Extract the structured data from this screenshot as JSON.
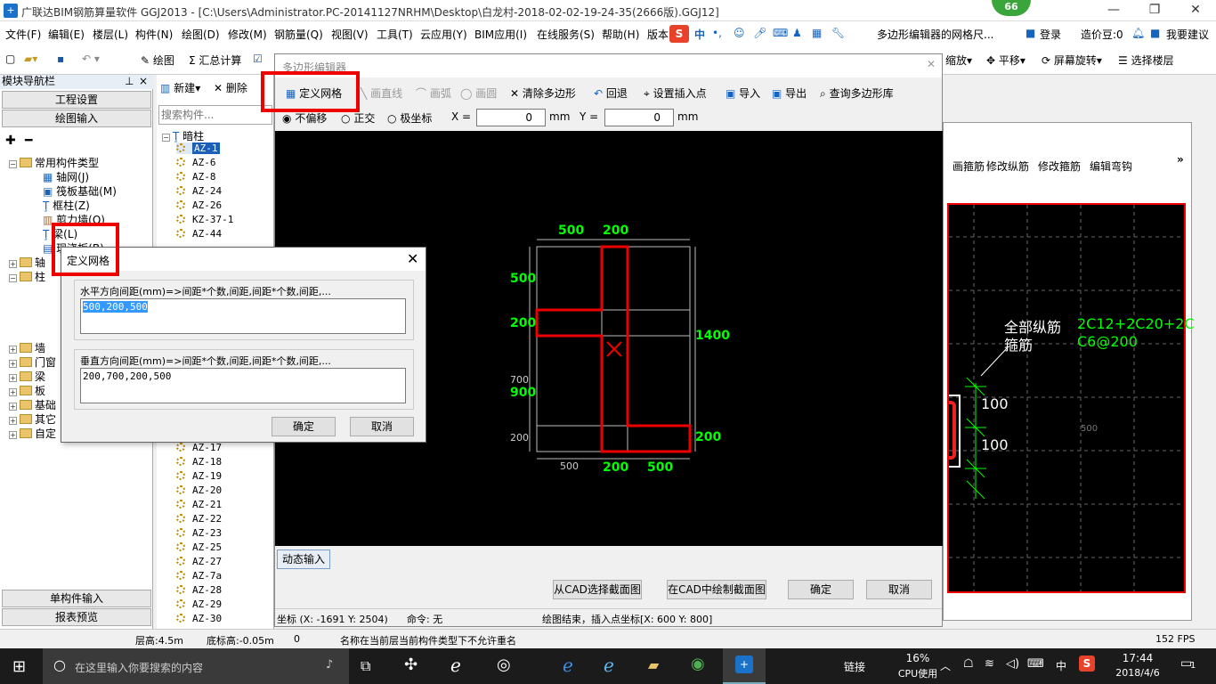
{
  "window": {
    "title": "广联达BIM钢筋算量软件 GGJ2013 - [C:\\Users\\Administrator.PC-20141127NRHM\\Desktop\\白龙村-2018-02-02-19-24-35(2666版).GGJ12]",
    "badge": "66"
  },
  "menu": [
    "文件(F)",
    "编辑(E)",
    "楼层(L)",
    "构件(N)",
    "绘图(D)",
    "修改(M)",
    "钢筋量(Q)",
    "视图(V)",
    "工具(T)",
    "云应用(Y)",
    "BIM应用(I)",
    "在线服务(S)",
    "帮助(H)",
    "版本"
  ],
  "menu_right": {
    "ad": "多边形编辑器的网格尺...",
    "login": "登录",
    "price": "造价豆:0",
    "suggest": "我要建议"
  },
  "toolbar": {
    "draw": "绘图",
    "sum": "汇总计算",
    "zoom": "缩放",
    "pan": "平移",
    "rotate": "屏幕旋转",
    "floor": "选择楼层"
  },
  "left_panel": {
    "header": "模块导航栏",
    "project_settings": "工程设置",
    "drawing_input": "绘图输入",
    "tree": [
      "常用构件类型",
      "轴网(J)",
      "筏板基础(M)",
      "框柱(Z)",
      "剪力墙(Q)",
      "梁(L)",
      "现浇板(B)",
      "轴",
      "柱",
      "墙",
      "门窗",
      "梁",
      "板",
      "基础",
      "其它",
      "自定"
    ],
    "single_input": "单构件输入",
    "report_preview": "报表预览"
  },
  "mid_panel": {
    "new": "新建",
    "delete": "删除",
    "search_placeholder": "搜索构件...",
    "root": "暗柱",
    "items_top": [
      "AZ-1",
      "AZ-6",
      "AZ-8",
      "AZ-24",
      "AZ-26",
      "KZ-37-1",
      "AZ-44"
    ],
    "items_bottom": [
      "AZ-17",
      "AZ-18",
      "AZ-19",
      "AZ-20",
      "AZ-21",
      "AZ-22",
      "AZ-23",
      "AZ-25",
      "AZ-27",
      "AZ-7a",
      "AZ-28",
      "AZ-29",
      "AZ-30"
    ]
  },
  "poly_editor": {
    "title": "多边形编辑器",
    "tools": {
      "define_grid": "定义网格",
      "line": "画直线",
      "arc": "画弧",
      "circle": "画圆",
      "clear": "清除多边形",
      "undo": "回退",
      "insert_point": "设置插入点",
      "import": "导入",
      "export": "导出",
      "query": "查询多边形库"
    },
    "modes": [
      "不偏移",
      "正交",
      "极坐标"
    ],
    "x_label": "X =",
    "x_value": "0",
    "y_label": "Y =",
    "y_value": "0",
    "unit": "mm",
    "dims": {
      "top1": "500",
      "top2": "200",
      "left1": "500",
      "left2": "200",
      "left3_white": "700",
      "left3_green": "900",
      "left4": "200",
      "right1": "1400",
      "right2": "200",
      "bot1": "500",
      "bot2": "200",
      "bot3": "500"
    },
    "dynamic_input": "动态输入",
    "btn_cad_select": "从CAD选择截面图",
    "btn_cad_draw": "在CAD中绘制截面图",
    "ok": "确定",
    "cancel": "取消",
    "status_coord": "坐标 (X: -1691 Y: 2504)",
    "status_cmd": "命令: 无",
    "status_msg": "绘图结束，插入点坐标[X: 600 Y: 800]"
  },
  "right_window": {
    "tabs": [
      "画箍筋",
      "修改纵筋",
      "修改箍筋",
      "编辑弯钩"
    ],
    "label1": "全部纵筋",
    "label2": "箍筋",
    "val1": "2C12+2C20+2C",
    "val2": "C6@200",
    "d1": "100",
    "d2": "100",
    "grid_label": "500"
  },
  "dialog": {
    "title": "定义网格",
    "h_label": "水平方向间距(mm)=>间距*个数,间距,间距*个数,间距,...",
    "h_value": "500,200,500",
    "v_label": "垂直方向间距(mm)=>间距*个数,间距,间距*个数,间距,...",
    "v_value": "200,700,200,500",
    "ok": "确定",
    "cancel": "取消"
  },
  "statusbar": {
    "floor_h": "层高:4.5m",
    "bottom_h": "底标高:-0.05m",
    "zero": "0",
    "msg": "名称在当前层当前构件类型下不允许重名",
    "fps": "152 FPS"
  },
  "taskbar": {
    "search": "在这里输入你要搜索的内容",
    "link": "链接",
    "cpu": "16%",
    "cpu_label": "CPU使用",
    "ime": "中",
    "time": "17:44",
    "date": "2018/4/6",
    "notif": "1"
  }
}
